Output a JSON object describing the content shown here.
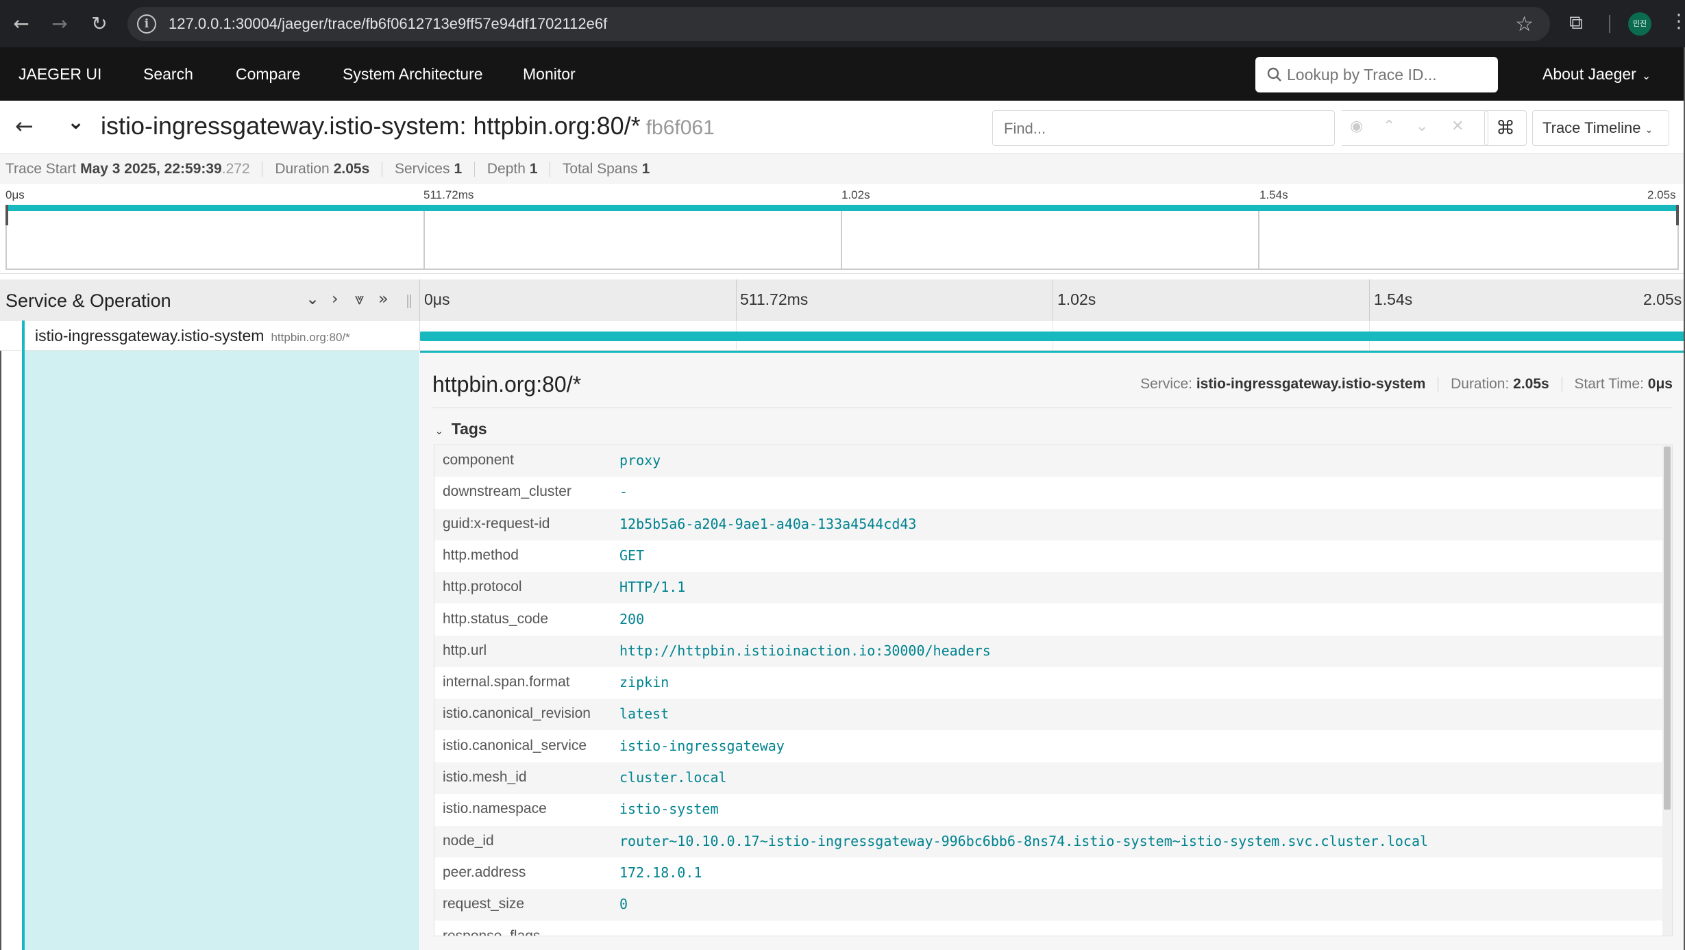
{
  "browser": {
    "url": "127.0.0.1:30004/jaeger/trace/fb6f0612713e9ff57e94df1702112e6f",
    "avatar": "민진"
  },
  "topnav": {
    "brand": "JAEGER UI",
    "items": [
      "Search",
      "Compare",
      "System Architecture",
      "Monitor"
    ],
    "lookup_placeholder": "Lookup by Trace ID...",
    "about": "About Jaeger"
  },
  "trace": {
    "title": "istio-ingressgateway.istio-system: httpbin.org:80/*",
    "short_id": "fb6f061",
    "find_placeholder": "Find...",
    "view_mode": "Trace Timeline"
  },
  "summary": {
    "trace_start_label": "Trace Start",
    "trace_start": "May 3 2025, 22:59:39",
    "trace_start_ms": ".272",
    "duration_label": "Duration",
    "duration": "2.05s",
    "services_label": "Services",
    "services": "1",
    "depth_label": "Depth",
    "depth": "1",
    "total_spans_label": "Total Spans",
    "total_spans": "1"
  },
  "ticks": [
    "0μs",
    "511.72ms",
    "1.02s",
    "1.54s",
    "2.05s"
  ],
  "span_header": {
    "title": "Service & Operation"
  },
  "span": {
    "service": "istio-ingressgateway.istio-system",
    "operation": "httpbin.org:80/*"
  },
  "detail": {
    "operation": "httpbin.org:80/*",
    "service_label": "Service:",
    "service": "istio-ingressgateway.istio-system",
    "duration_label": "Duration:",
    "duration": "2.05s",
    "start_label": "Start Time:",
    "start": "0μs",
    "tags_label": "Tags",
    "tags": [
      {
        "key": "component",
        "value": "proxy"
      },
      {
        "key": "downstream_cluster",
        "value": "-"
      },
      {
        "key": "guid:x-request-id",
        "value": "12b5b5a6-a204-9ae1-a40a-133a4544cd43"
      },
      {
        "key": "http.method",
        "value": "GET"
      },
      {
        "key": "http.protocol",
        "value": "HTTP/1.1"
      },
      {
        "key": "http.status_code",
        "value": "200"
      },
      {
        "key": "http.url",
        "value": "http://httpbin.istioinaction.io:30000/headers"
      },
      {
        "key": "internal.span.format",
        "value": "zipkin"
      },
      {
        "key": "istio.canonical_revision",
        "value": "latest"
      },
      {
        "key": "istio.canonical_service",
        "value": "istio-ingressgateway"
      },
      {
        "key": "istio.mesh_id",
        "value": "cluster.local"
      },
      {
        "key": "istio.namespace",
        "value": "istio-system"
      },
      {
        "key": "node_id",
        "value": "router~10.10.0.17~istio-ingressgateway-996bc6bb6-8ns74.istio-system~istio-system.svc.cluster.local"
      },
      {
        "key": "peer.address",
        "value": "172.18.0.1"
      },
      {
        "key": "request_size",
        "value": "0"
      },
      {
        "key": "response_flags",
        "value": ""
      }
    ]
  }
}
